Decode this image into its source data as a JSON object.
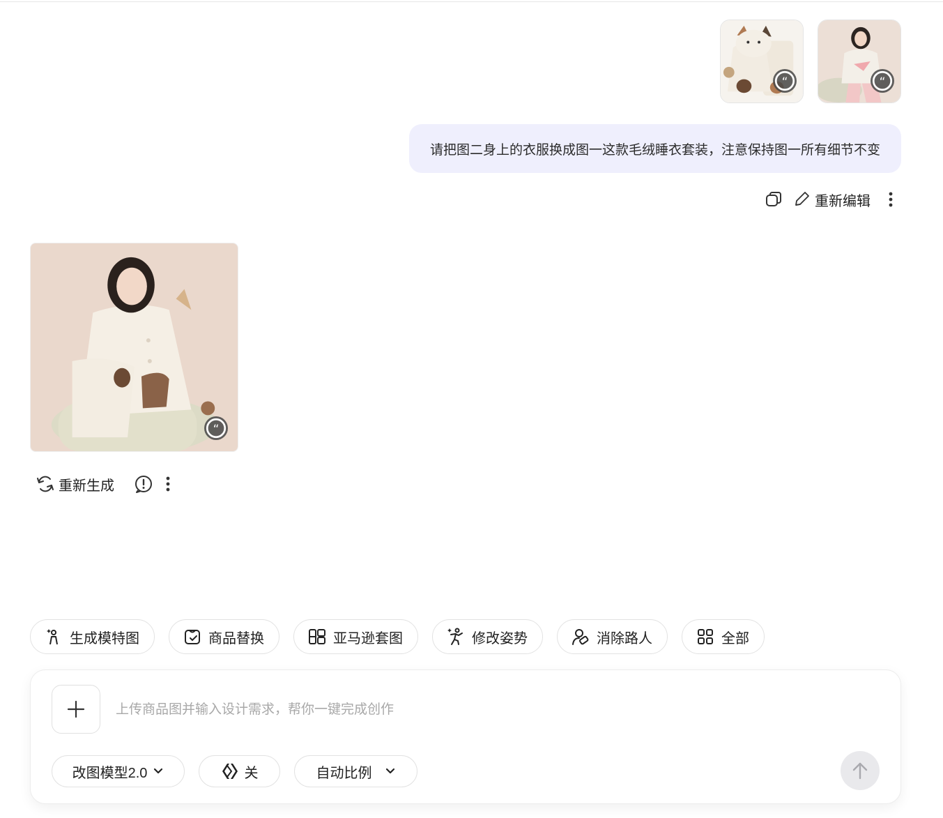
{
  "conversation": {
    "user_message": {
      "attachments": [
        {
          "icon": "quote-icon"
        },
        {
          "icon": "quote-icon"
        }
      ],
      "text": "请把图二身上的衣服换成图一这款毛绒睡衣套装，注意保持图一所有细节不变",
      "actions": {
        "copy_icon": "copy-icon",
        "edit_label": "重新编辑",
        "more_icon": "more-vertical-icon"
      }
    },
    "result": {
      "icon": "quote-icon",
      "actions": {
        "regenerate_label": "重新生成",
        "report_icon": "report-icon",
        "more_icon": "more-vertical-icon"
      }
    }
  },
  "quick_actions": [
    {
      "label": "生成模特图",
      "icon": "model-icon"
    },
    {
      "label": "商品替换",
      "icon": "product-swap-icon"
    },
    {
      "label": "亚马逊套图",
      "icon": "amazon-set-icon"
    },
    {
      "label": "修改姿势",
      "icon": "pose-icon"
    },
    {
      "label": "消除路人",
      "icon": "remove-person-icon"
    },
    {
      "label": "全部",
      "icon": "grid-icon"
    }
  ],
  "composer": {
    "placeholder": "上传商品图并输入设计需求，帮你一键完成创作",
    "model_label": "改图模型2.0",
    "toggle_label": "关",
    "ratio_label": "自动比例"
  },
  "colors": {
    "bubble_bg": "#efeffd",
    "send_button_bg": "#e9e9ec",
    "badge_bg": "#464646"
  }
}
